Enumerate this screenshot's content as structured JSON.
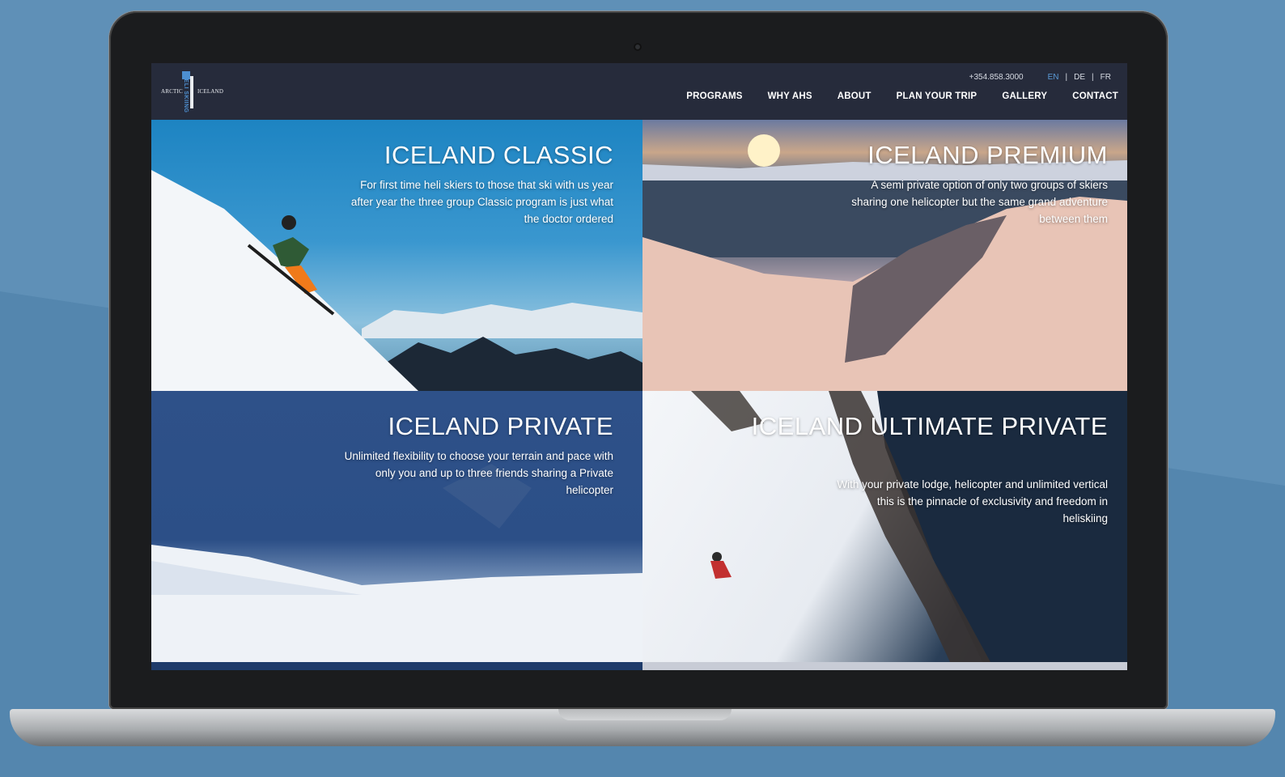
{
  "header": {
    "logo": {
      "left": "ARCTIC",
      "right": "ICELAND",
      "vertical": "HELI SKIING"
    },
    "phone": "+354.858.3000",
    "languages": [
      {
        "label": "EN",
        "active": true
      },
      {
        "label": "DE",
        "active": false
      },
      {
        "label": "FR",
        "active": false
      }
    ],
    "separator": "|",
    "nav": [
      "PROGRAMS",
      "WHY AHS",
      "ABOUT",
      "PLAN YOUR TRIP",
      "GALLERY",
      "CONTACT"
    ]
  },
  "programs": [
    {
      "title": "ICELAND CLASSIC",
      "description": "For first time heli skiers to those that ski with us year after year the three group Classic program is just what the doctor ordered"
    },
    {
      "title": "ICELAND PREMIUM",
      "description": "A semi private option of only two groups of skiers sharing one helicopter but the same grand adventure between them"
    },
    {
      "title": "ICELAND PRIVATE",
      "description": "Unlimited flexibility to choose your terrain and pace with only you and up to three friends sharing a Private helicopter"
    },
    {
      "title": "ICELAND ULTIMATE PRIVATE",
      "description": "With your private lodge, helicopter and unlimited vertical this is the pinnacle of exclusivity and freedom in heliskiing"
    }
  ],
  "colors": {
    "accent": "#5a9ad6",
    "header_bg": "#262b3b",
    "page_bg": "#5f90b7"
  }
}
